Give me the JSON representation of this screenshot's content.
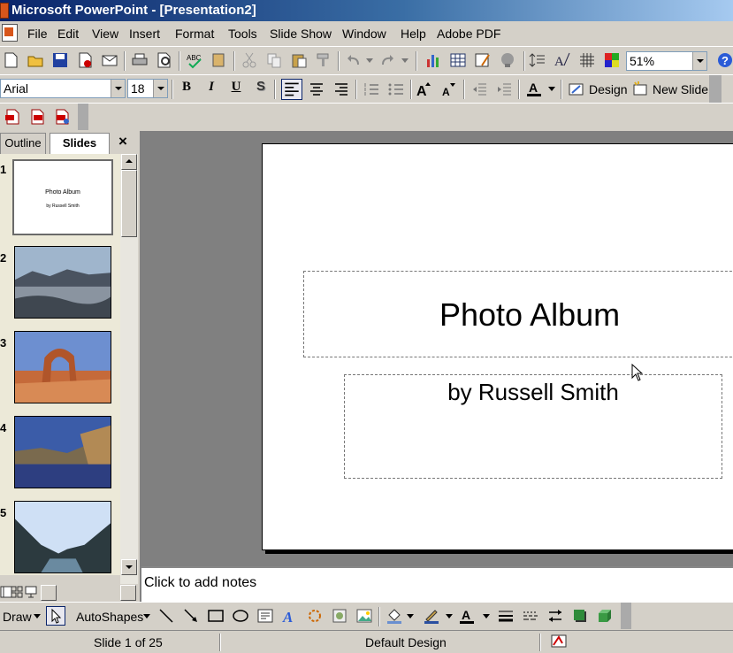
{
  "window": {
    "title": "Microsoft PowerPoint - [Presentation2]"
  },
  "menu": [
    "File",
    "Edit",
    "View",
    "Insert",
    "Format",
    "Tools",
    "Slide Show",
    "Window",
    "Help",
    "Adobe PDF"
  ],
  "standard_toolbar": {
    "zoom": "51%"
  },
  "formatting_toolbar": {
    "font": "Arial",
    "size": "18",
    "bold": "B",
    "italic": "I",
    "underline": "U",
    "shadow": "S",
    "design_label": "Design",
    "new_slide_label": "New Slide"
  },
  "left_pane": {
    "tabs": [
      "Outline",
      "Slides"
    ],
    "close": "×",
    "thumbnails": [
      {
        "num": "1",
        "title": "Photo Album",
        "subtitle": "by Russell Smith"
      },
      {
        "num": "2"
      },
      {
        "num": "3"
      },
      {
        "num": "4"
      },
      {
        "num": "5"
      }
    ]
  },
  "slide": {
    "title": "Photo Album",
    "subtitle": "by Russell Smith"
  },
  "notes": {
    "placeholder": "Click to add notes"
  },
  "drawing_toolbar": {
    "draw_label": "Draw",
    "autoshapes_label": "AutoShapes"
  },
  "status": {
    "slide_position": "Slide 1 of 25",
    "design": "Default Design"
  }
}
